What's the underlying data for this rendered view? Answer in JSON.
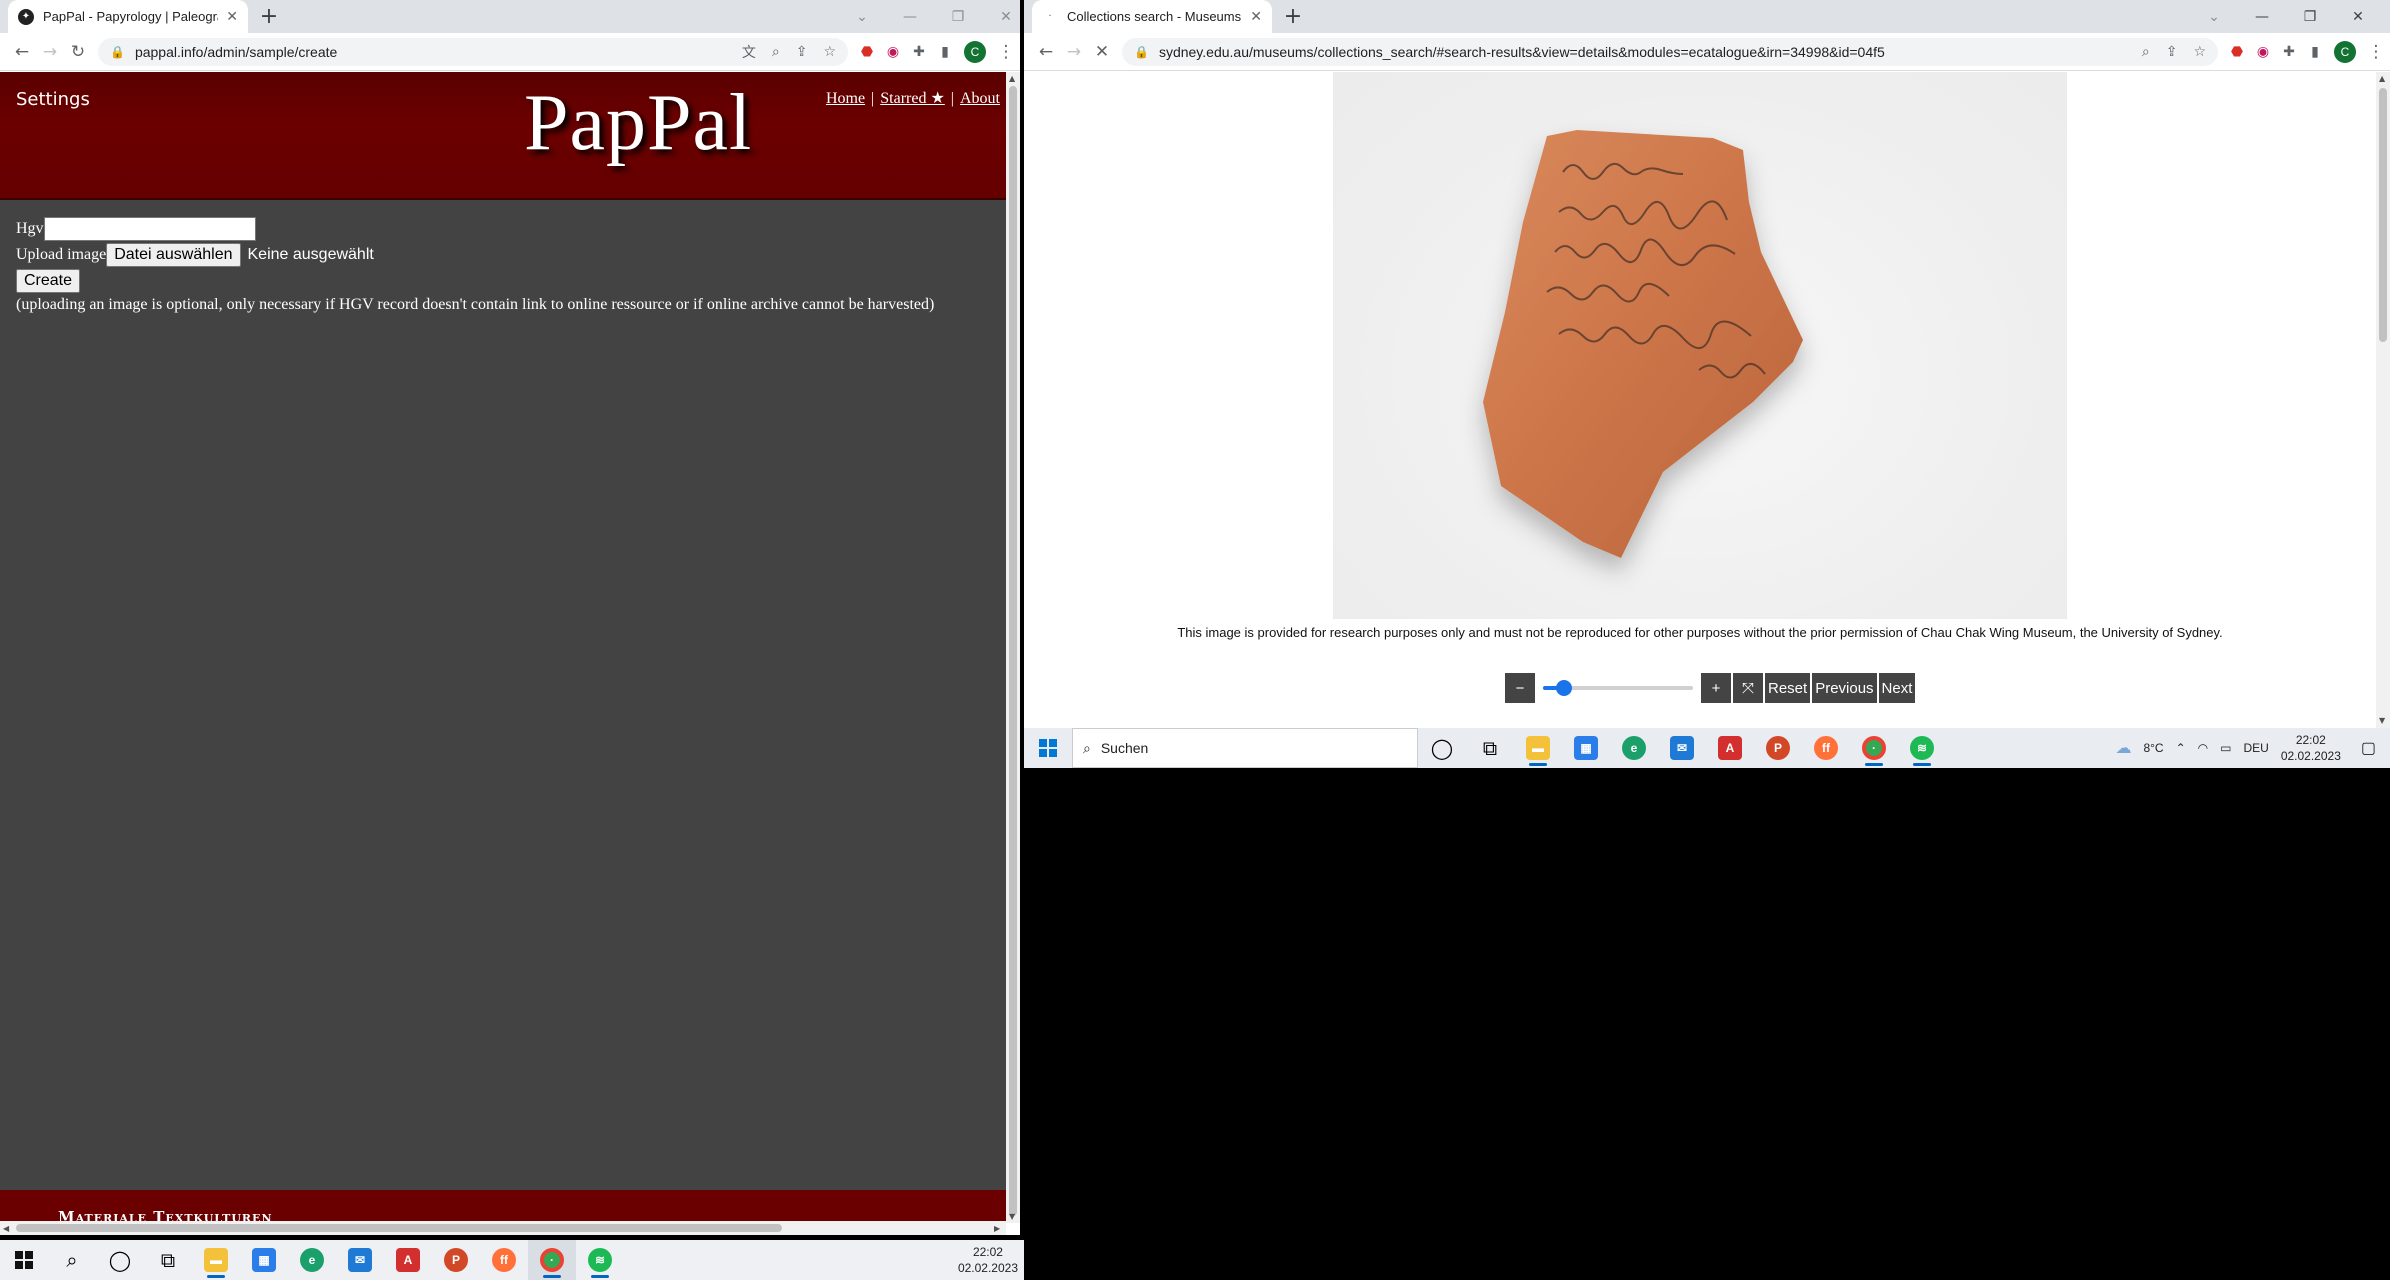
{
  "left_window": {
    "tab_title": "PapPal - Papyrology | Paleograph",
    "url": "pappal.info/admin/sample/create"
  },
  "pappal": {
    "settings": "Settings",
    "logo": "PapPal",
    "nav": {
      "home": "Home",
      "starred": "Starred ★",
      "about": "About",
      "sep": "|"
    },
    "form": {
      "hgv_label": "Hgv",
      "upload_label": "Upload image",
      "choose_file": "Datei auswählen",
      "no_file": "Keine ausgewählt",
      "create": "Create",
      "note": "(uploading an image is optional, only necessary if HGV record doesn't contain link to online ressource or if online archive cannot be harvested)"
    },
    "footer": "Materiale Textkulturen"
  },
  "right_window": {
    "tab_title": "Collections search - Museums - The University of Sydney",
    "url": "sydney.edu.au/museums/collections_search/#search-results&view=details&modules=ecatalogue&irn=34998&id=04f5"
  },
  "sydney": {
    "disclaimer": "This image is provided for research purposes only and must not be reproduced for other purposes without the prior permission of Chau Chak Wing Museum, the University of Sydney.",
    "zoom_out": "−",
    "zoom_in": "+",
    "fullscreen": "⤧",
    "reset": "Reset",
    "previous": "Previous",
    "next": "Next",
    "zoom_level_fraction": 0.1
  },
  "taskbar_main": {
    "time": "22:02",
    "date": "02.02.2023"
  },
  "taskbar_secondary": {
    "search": "Suchen",
    "weather": "8°C",
    "lang": "DEU",
    "time": "22:02",
    "date": "02.02.2023"
  },
  "colors": {
    "pappal_red": "#6b0000",
    "pappal_gray": "#434343",
    "chrome_tab_bg": "#dee1e6",
    "slider_blue": "#1a73e8"
  }
}
